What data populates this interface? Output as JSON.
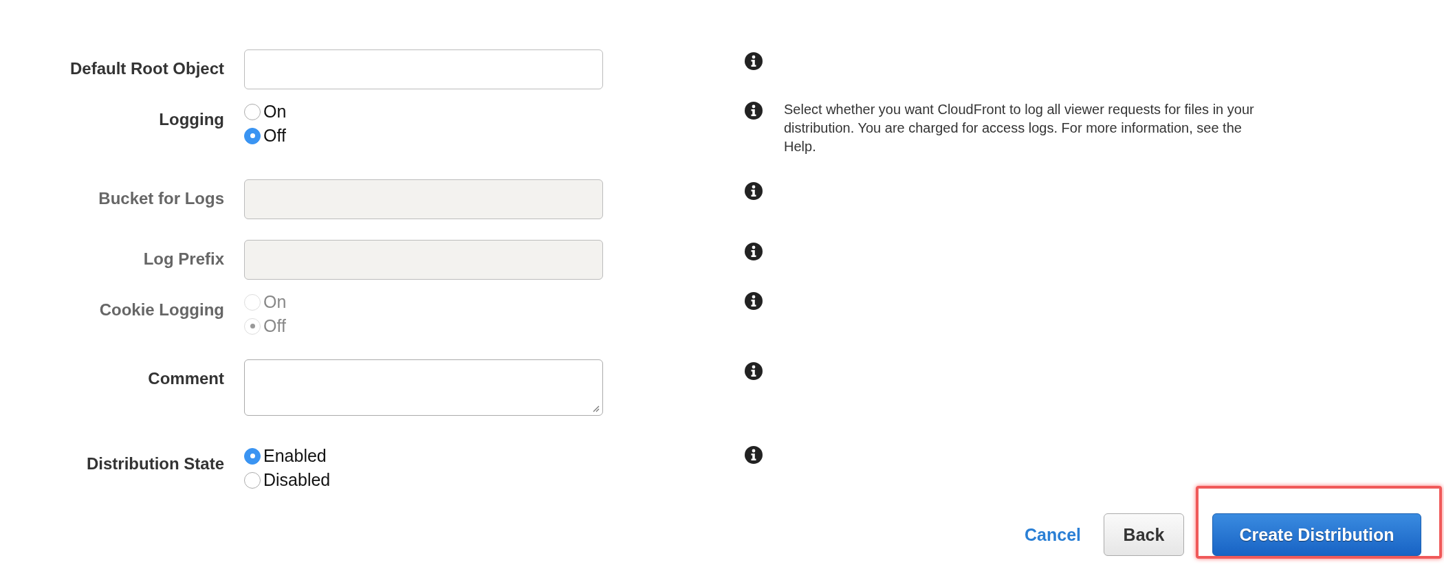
{
  "fields": [
    {
      "kind": "text",
      "label": "Default Root Object",
      "disabled": false
    },
    {
      "kind": "radio",
      "label": "Logging",
      "disabled": false,
      "options": [
        {
          "label": "On",
          "selected": false
        },
        {
          "label": "Off",
          "selected": true
        }
      ],
      "help": "Select whether you want CloudFront to log all viewer requests for files in your distribution. You are charged for access logs. For more information, see the Help."
    },
    {
      "kind": "text",
      "label": "Bucket for Logs",
      "disabled": true
    },
    {
      "kind": "text",
      "label": "Log Prefix",
      "disabled": true
    },
    {
      "kind": "radio",
      "label": "Cookie Logging",
      "disabled": true,
      "options": [
        {
          "label": "On",
          "selected": false
        },
        {
          "label": "Off",
          "selected": true
        }
      ]
    },
    {
      "kind": "textarea",
      "label": "Comment",
      "disabled": false
    },
    {
      "kind": "radio",
      "label": "Distribution State",
      "disabled": false,
      "options": [
        {
          "label": "Enabled",
          "selected": true
        },
        {
          "label": "Disabled",
          "selected": false
        }
      ]
    }
  ],
  "actions": {
    "cancel": "Cancel",
    "back": "Back",
    "create": {
      "label": "Create Distribution",
      "highlighted": true
    }
  }
}
